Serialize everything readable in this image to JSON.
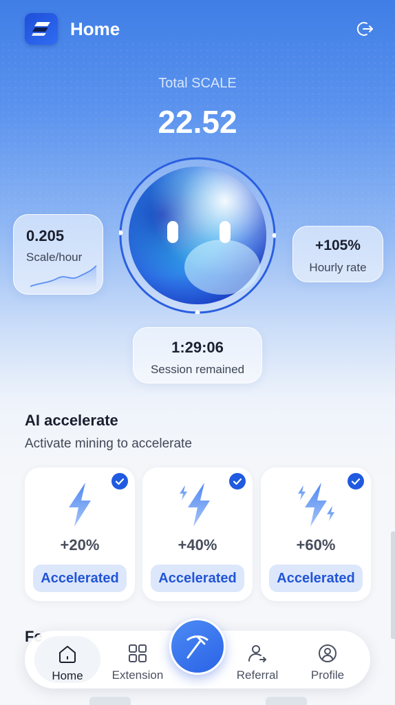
{
  "header": {
    "title": "Home",
    "logo_icon": "scale-logo-icon",
    "logout_icon": "logout-icon"
  },
  "total": {
    "label": "Total SCALE",
    "value": "22.52"
  },
  "rate_card": {
    "value": "0.205",
    "unit": "Scale/hour"
  },
  "hourly_card": {
    "value": "+105%",
    "label": "Hourly rate"
  },
  "session_card": {
    "time": "1:29:06",
    "label": "Session remained"
  },
  "ai_section": {
    "title": "AI accelerate",
    "subtitle": "Activate mining to accelerate"
  },
  "accelerators": [
    {
      "percent": "+20%",
      "button": "Accelerated",
      "checked": true,
      "icon": "bolt-single-icon"
    },
    {
      "percent": "+40%",
      "button": "Accelerated",
      "checked": true,
      "icon": "bolt-double-icon"
    },
    {
      "percent": "+60%",
      "button": "Accelerated",
      "checked": true,
      "icon": "bolt-triple-icon"
    }
  ],
  "next_section_peek": "Fe",
  "nav": {
    "home": "Home",
    "extension": "Extension",
    "mine_icon": "pickaxe-icon",
    "referral": "Referral",
    "profile": "Profile"
  },
  "colors": {
    "accent": "#2a63e6",
    "button_bg": "#dde7fb",
    "button_text": "#2055d6"
  }
}
